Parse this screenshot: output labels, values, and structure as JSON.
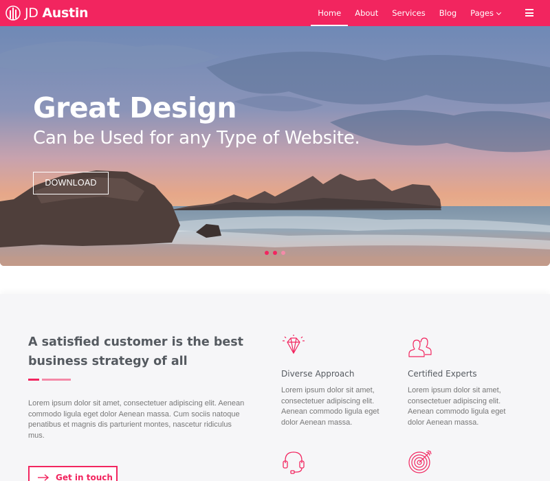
{
  "header": {
    "logo_prefix": "JD",
    "logo_name": "Austin",
    "nav": [
      {
        "label": "Home"
      },
      {
        "label": "About"
      },
      {
        "label": "Services"
      },
      {
        "label": "Blog"
      },
      {
        "label": "Pages"
      }
    ]
  },
  "hero": {
    "title": "Great Design",
    "subtitle": "Can be Used for any Type of Website.",
    "button": "DOWNLOAD",
    "active_slide": 1,
    "slide_count": 3
  },
  "section": {
    "title": "A satisfied customer is the best business strategy of all",
    "paragraph": "Lorem ipsum dolor sit amet, consectetuer adipiscing elit. Aenean commodo ligula eget dolor Aenean massa. Cum sociis natoque penatibus et magnis dis parturient montes, nascetur ridiculus mus.",
    "button": "Get in touch",
    "features": [
      {
        "icon": "diamond-icon",
        "title": "Diverse Approach",
        "text": "Lorem ipsum dolor sit amet, consectetuer adipiscing elit. Aenean commodo ligula eget dolor Aenean massa."
      },
      {
        "icon": "users-icon",
        "title": "Certified Experts",
        "text": "Lorem ipsum dolor sit amet, consectetuer adipiscing elit. Aenean commodo ligula eget dolor Aenean massa."
      },
      {
        "icon": "headset-icon",
        "title": "",
        "text": ""
      },
      {
        "icon": "target-icon",
        "title": "",
        "text": ""
      }
    ]
  },
  "colors": {
    "accent": "#f2255f",
    "accent_light": "#f48aa8",
    "section_bg": "#f6f6f8"
  }
}
